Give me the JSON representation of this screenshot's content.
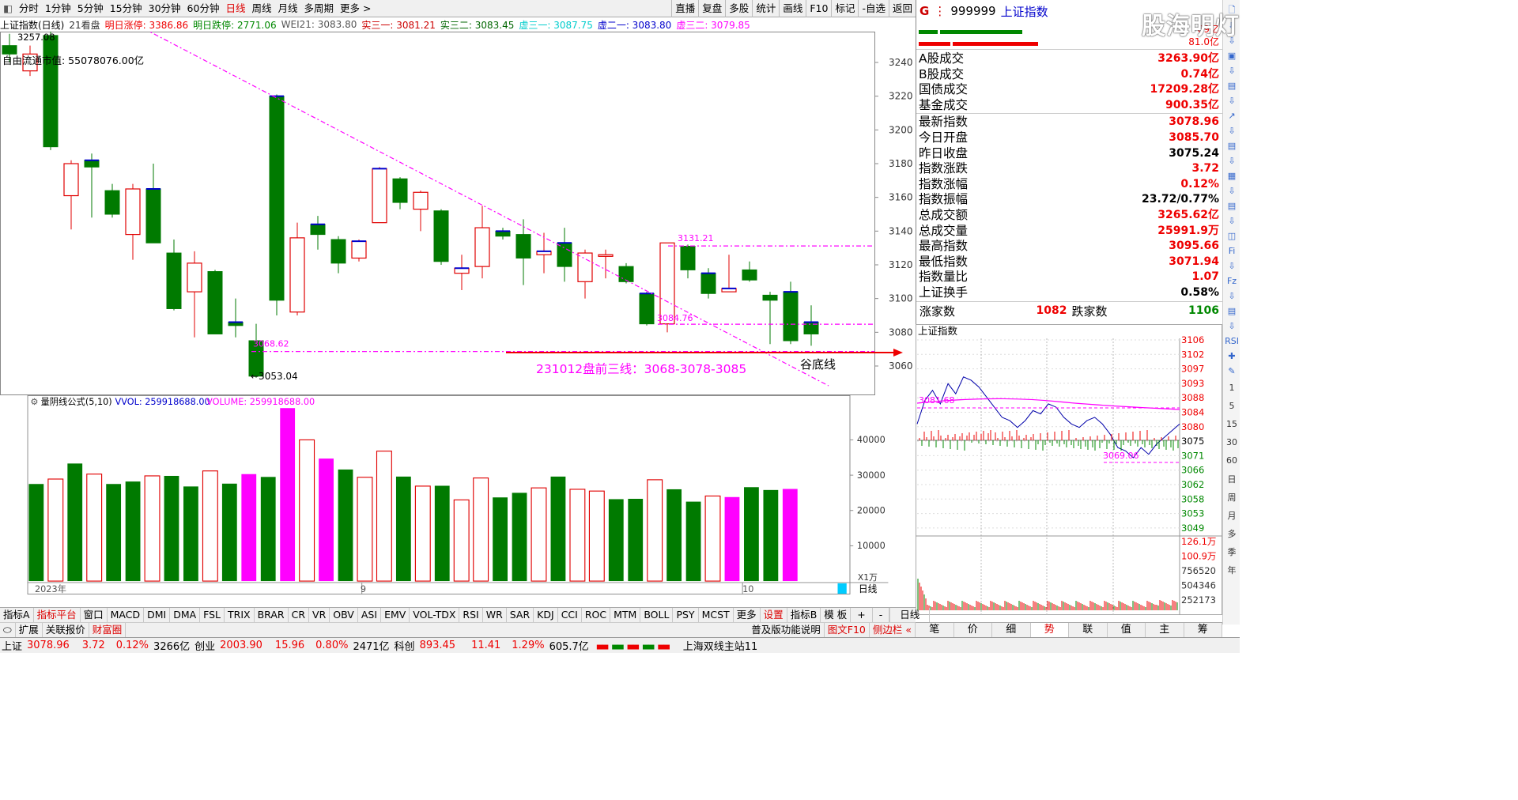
{
  "toolbar": {
    "left": [
      "分时",
      "1分钟",
      "5分钟",
      "15分钟",
      "30分钟",
      "60分钟",
      "日线",
      "周线",
      "月线",
      "多周期",
      "更多 >"
    ],
    "active_index": 6,
    "right": [
      "直播",
      "复盘",
      "多股",
      "统计",
      "画线",
      "F10",
      "标记",
      "-自选",
      "返回"
    ]
  },
  "info": {
    "name": "上证指数(日线)",
    "kanpan": "21看盘",
    "limit_up": "明日涨停: 3386.86",
    "limit_down": "明日跌停: 2771.06",
    "wei": "WEI21: 3083.80",
    "s31": "实三一: 3081.21",
    "s32": "实三二: 3083.45",
    "x31": "虚三一: 3087.75",
    "x21": "虚二一: 3083.80",
    "x32": "虚三二: 3079.85"
  },
  "chart_overlay": {
    "prev_high": "3257.08",
    "float_cap": "自由流通市值: 55078076.00亿",
    "low_label": "←3053.04",
    "label_3068": "3068.62",
    "label_3131": "3131.21",
    "label_3084": "3084.76",
    "annotation": "231012盘前三线：3068-3078-3085",
    "valley_line": "谷底线",
    "year_label": "2023年",
    "month9": "9",
    "month10": "10",
    "unit": "X1万",
    "period": "日线"
  },
  "chart_data": {
    "type": "candlestick",
    "title": "上证指数(日线)",
    "y_ticks": [
      3060,
      3080,
      3100,
      3120,
      3140,
      3160,
      3180,
      3200,
      3220,
      3240
    ],
    "candles": [
      {
        "o": 3250,
        "c": 3245,
        "h": 3257,
        "l": 3240,
        "up": false
      },
      {
        "o": 3235,
        "c": 3245,
        "h": 3250,
        "l": 3232,
        "up": true
      },
      {
        "o": 3256,
        "c": 3190,
        "h": 3260,
        "l": 3188,
        "up": false
      },
      {
        "o": 3161,
        "c": 3180,
        "h": 3182,
        "l": 3141,
        "up": true
      },
      {
        "o": 3182,
        "c": 3178,
        "h": 3186,
        "l": 3148,
        "up": false
      },
      {
        "o": 3164,
        "c": 3150,
        "h": 3168,
        "l": 3148,
        "up": false
      },
      {
        "o": 3138,
        "c": 3165,
        "h": 3168,
        "l": 3123,
        "up": true
      },
      {
        "o": 3165,
        "c": 3133,
        "h": 3180,
        "l": 3133,
        "up": false
      },
      {
        "o": 3127,
        "c": 3094,
        "h": 3135,
        "l": 3093,
        "up": false
      },
      {
        "o": 3104,
        "c": 3121,
        "h": 3128,
        "l": 3077,
        "up": true
      },
      {
        "o": 3116,
        "c": 3079,
        "h": 3117,
        "l": 3079,
        "up": false
      },
      {
        "o": 3086,
        "c": 3084,
        "h": 3100,
        "l": 3077,
        "up": false
      },
      {
        "o": 3075,
        "c": 3054,
        "h": 3085,
        "l": 3053,
        "up": false
      },
      {
        "o": 3220,
        "c": 3099,
        "h": 3221,
        "l": 3090,
        "up": false
      },
      {
        "o": 3092,
        "c": 3136,
        "h": 3145,
        "l": 3090,
        "up": true
      },
      {
        "o": 3144,
        "c": 3138,
        "h": 3149,
        "l": 3129,
        "up": false
      },
      {
        "o": 3135,
        "c": 3121,
        "h": 3137,
        "l": 3115,
        "up": false
      },
      {
        "o": 3124,
        "c": 3134,
        "h": 3135,
        "l": 3122,
        "up": true
      },
      {
        "o": 3145,
        "c": 3177,
        "h": 3178,
        "l": 3145,
        "up": true
      },
      {
        "o": 3171,
        "c": 3157,
        "h": 3172,
        "l": 3153,
        "up": false
      },
      {
        "o": 3153,
        "c": 3163,
        "h": 3164,
        "l": 3140,
        "up": true
      },
      {
        "o": 3152,
        "c": 3122,
        "h": 3153,
        "l": 3120,
        "up": false
      },
      {
        "o": 3115,
        "c": 3118,
        "h": 3126,
        "l": 3105,
        "up": true
      },
      {
        "o": 3119,
        "c": 3142,
        "h": 3155,
        "l": 3112,
        "up": true
      },
      {
        "o": 3140,
        "c": 3137,
        "h": 3142,
        "l": 3135,
        "up": false
      },
      {
        "o": 3138,
        "c": 3124,
        "h": 3147,
        "l": 3108,
        "up": false
      },
      {
        "o": 3126,
        "c": 3128,
        "h": 3139,
        "l": 3115,
        "up": true
      },
      {
        "o": 3133,
        "c": 3119,
        "h": 3142,
        "l": 3110,
        "up": false
      },
      {
        "o": 3110,
        "c": 3127,
        "h": 3129,
        "l": 3100,
        "up": true
      },
      {
        "o": 3125,
        "c": 3126,
        "h": 3129,
        "l": 3112,
        "up": true
      },
      {
        "o": 3119,
        "c": 3110,
        "h": 3121,
        "l": 3109,
        "up": false
      },
      {
        "o": 3103,
        "c": 3085,
        "h": 3104,
        "l": 3084,
        "up": false
      },
      {
        "o": 3085,
        "c": 3133,
        "h": 3133,
        "l": 3080,
        "up": true
      },
      {
        "o": 3131,
        "c": 3117,
        "h": 3132,
        "l": 3112,
        "up": false
      },
      {
        "o": 3115,
        "c": 3103,
        "h": 3118,
        "l": 3100,
        "up": false
      },
      {
        "o": 3104,
        "c": 3106,
        "h": 3126,
        "l": 3104,
        "up": true
      },
      {
        "o": 3117,
        "c": 3111,
        "h": 3122,
        "l": 3110,
        "up": false
      },
      {
        "o": 3102,
        "c": 3099,
        "h": 3104,
        "l": 3073,
        "up": false
      },
      {
        "o": 3104,
        "c": 3075,
        "h": 3110,
        "l": 3073,
        "up": false
      },
      {
        "o": 3086,
        "c": 3079,
        "h": 3096,
        "l": 3072,
        "up": false
      }
    ],
    "volume_ticks": [
      10000,
      20000,
      30000,
      40000
    ],
    "volumes": [
      {
        "v": 27500,
        "c": "g"
      },
      {
        "v": 28900,
        "c": "r"
      },
      {
        "v": 33300,
        "c": "g"
      },
      {
        "v": 30300,
        "c": "r"
      },
      {
        "v": 27500,
        "c": "g"
      },
      {
        "v": 28200,
        "c": "g"
      },
      {
        "v": 29800,
        "c": "r"
      },
      {
        "v": 29800,
        "c": "g"
      },
      {
        "v": 26800,
        "c": "g"
      },
      {
        "v": 31200,
        "c": "r"
      },
      {
        "v": 27600,
        "c": "g"
      },
      {
        "v": 30300,
        "c": "m"
      },
      {
        "v": 29500,
        "c": "g"
      },
      {
        "v": 49000,
        "c": "m"
      },
      {
        "v": 40000,
        "c": "r"
      },
      {
        "v": 34700,
        "c": "m"
      },
      {
        "v": 31600,
        "c": "g"
      },
      {
        "v": 29400,
        "c": "r"
      },
      {
        "v": 36800,
        "c": "r"
      },
      {
        "v": 29600,
        "c": "g"
      },
      {
        "v": 26900,
        "c": "r"
      },
      {
        "v": 27000,
        "c": "g"
      },
      {
        "v": 23000,
        "c": "r"
      },
      {
        "v": 29200,
        "c": "r"
      },
      {
        "v": 23700,
        "c": "g"
      },
      {
        "v": 25000,
        "c": "g"
      },
      {
        "v": 26400,
        "c": "r"
      },
      {
        "v": 29600,
        "c": "g"
      },
      {
        "v": 26000,
        "c": "r"
      },
      {
        "v": 25500,
        "c": "r"
      },
      {
        "v": 23200,
        "c": "g"
      },
      {
        "v": 23300,
        "c": "g"
      },
      {
        "v": 28700,
        "c": "r"
      },
      {
        "v": 26000,
        "c": "g"
      },
      {
        "v": 22500,
        "c": "g"
      },
      {
        "v": 24100,
        "c": "r"
      },
      {
        "v": 23800,
        "c": "m"
      },
      {
        "v": 26600,
        "c": "g"
      },
      {
        "v": 25800,
        "c": "g"
      },
      {
        "v": 26100,
        "c": "m"
      }
    ]
  },
  "vol_header": {
    "name": "量阴线公式(5,10)",
    "vvol": "VVOL: 259918688.00",
    "volume": "VOLUME: 259918688.00"
  },
  "right": {
    "code": "999999",
    "name": "上证指数",
    "top_vals": [
      "89亿",
      "81.0亿"
    ],
    "rows1": [
      {
        "k": "A股成交",
        "v": "3263.90亿",
        "c": "red"
      },
      {
        "k": "B股成交",
        "v": "0.74亿",
        "c": "red"
      },
      {
        "k": "国债成交",
        "v": "17209.28亿",
        "c": "red"
      },
      {
        "k": "基金成交",
        "v": "900.35亿",
        "c": "red"
      }
    ],
    "rows2": [
      {
        "k": "最新指数",
        "v": "3078.96",
        "c": "red"
      },
      {
        "k": "今日开盘",
        "v": "3085.70",
        "c": "red"
      },
      {
        "k": "昨日收盘",
        "v": "3075.24",
        "c": "blk"
      },
      {
        "k": "指数涨跌",
        "v": "3.72",
        "c": "red"
      },
      {
        "k": "指数涨幅",
        "v": "0.12%",
        "c": "red"
      },
      {
        "k": "指数振幅",
        "v": "23.72/0.77%",
        "c": "blk"
      },
      {
        "k": "总成交额",
        "v": "3265.62亿",
        "c": "red"
      },
      {
        "k": "总成交量",
        "v": "25991.9万",
        "c": "red"
      },
      {
        "k": "最高指数",
        "v": "3095.66",
        "c": "red"
      },
      {
        "k": "最低指数",
        "v": "3071.94",
        "c": "red"
      },
      {
        "k": "指数量比",
        "v": "1.07",
        "c": "red"
      },
      {
        "k": "上证换手",
        "v": "0.58%",
        "c": "blk"
      }
    ],
    "rise_label": "涨家数",
    "rise": "1082",
    "fall_label": "跌家数",
    "fall": "1106",
    "mini_title": "上证指数",
    "mini_price_ticks": [
      "3106",
      "3102",
      "3097",
      "3093",
      "3088",
      "3084",
      "3080",
      "3075",
      "3071",
      "3066",
      "3062",
      "3058",
      "3053",
      "3049"
    ],
    "mini_vol_ticks": [
      "126.1万",
      "100.9万",
      "756520",
      "504346",
      "252173"
    ],
    "mini_label_a": "3081.68",
    "mini_label_b": "3069.06",
    "tabs": [
      "笔",
      "价",
      "细",
      "势",
      "联",
      "值",
      "主",
      "筹"
    ],
    "active_tab": 3
  },
  "sidebar": [
    "1",
    "5",
    "15",
    "30",
    "60",
    "日",
    "周",
    "月",
    "多",
    "季",
    "年"
  ],
  "tabs1": [
    "指标A",
    "指标平台",
    "窗口",
    "MACD",
    "DMI",
    "DMA",
    "FSL",
    "TRIX",
    "BRAR",
    "CR",
    "VR",
    "OBV",
    "ASI",
    "EMV",
    "VOL-TDX",
    "RSI",
    "WR",
    "SAR",
    "KDJ",
    "CCI",
    "ROC",
    "MTM",
    "BOLL",
    "PSY",
    "MCST",
    "更多",
    "设置"
  ],
  "tabs1_right": [
    "指标B",
    "模 板",
    "+",
    "-",
    "日线"
  ],
  "tabs2": [
    "扩展",
    "关联报价",
    "财富圈"
  ],
  "tabs2_right": [
    "普及版功能说明",
    "图文F10",
    "侧边栏 «"
  ],
  "status": {
    "sh": "上证",
    "sh_val": "3078.96",
    "sh_chg": "3.72",
    "sh_pct": "0.12%",
    "sh_amt": "3266亿",
    "cy": "创业",
    "cy_val": "2003.90",
    "cy_chg": "15.96",
    "cy_pct": "0.80%",
    "cy_amt": "2471亿",
    "kc": "科创",
    "kc_val": "893.45",
    "kc_chg": "11.41",
    "kc_pct": "1.29%",
    "kc_amt": "605.7亿",
    "server": "上海双线主站11"
  },
  "watermark": "股海明灯",
  "colors": {
    "up": "#e00000",
    "down": "#007a00",
    "magenta": "#ff00ff",
    "accent": "#d00"
  }
}
